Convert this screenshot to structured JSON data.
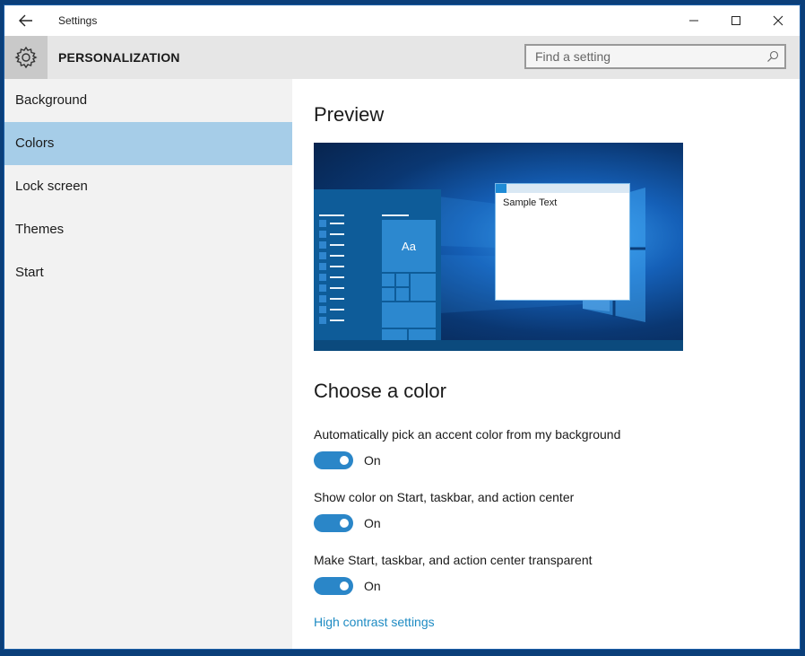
{
  "window": {
    "title": "Settings"
  },
  "header": {
    "page_title": "PERSONALIZATION",
    "search": {
      "placeholder": "Find a setting",
      "value": ""
    }
  },
  "sidebar": {
    "items": [
      {
        "label": "Background",
        "selected": false
      },
      {
        "label": "Colors",
        "selected": true
      },
      {
        "label": "Lock screen",
        "selected": false
      },
      {
        "label": "Themes",
        "selected": false
      },
      {
        "label": "Start",
        "selected": false
      }
    ]
  },
  "content": {
    "preview_title": "Preview",
    "preview": {
      "sample_text": "Sample Text",
      "tile_text": "Aa"
    },
    "choose_title": "Choose a color",
    "settings": [
      {
        "label": "Automatically pick an accent color from my background",
        "state": "On"
      },
      {
        "label": "Show color on Start, taskbar, and action center",
        "state": "On"
      },
      {
        "label": "Make Start, taskbar, and action center transparent",
        "state": "On"
      }
    ],
    "link": "High contrast settings"
  },
  "colors": {
    "accent": "#2a86c8",
    "selected_nav": "#a6cde8",
    "link": "#1e8bc3"
  },
  "icons": [
    "back-arrow-icon",
    "minimize-icon",
    "maximize-icon",
    "close-icon",
    "gear-icon",
    "search-icon"
  ]
}
